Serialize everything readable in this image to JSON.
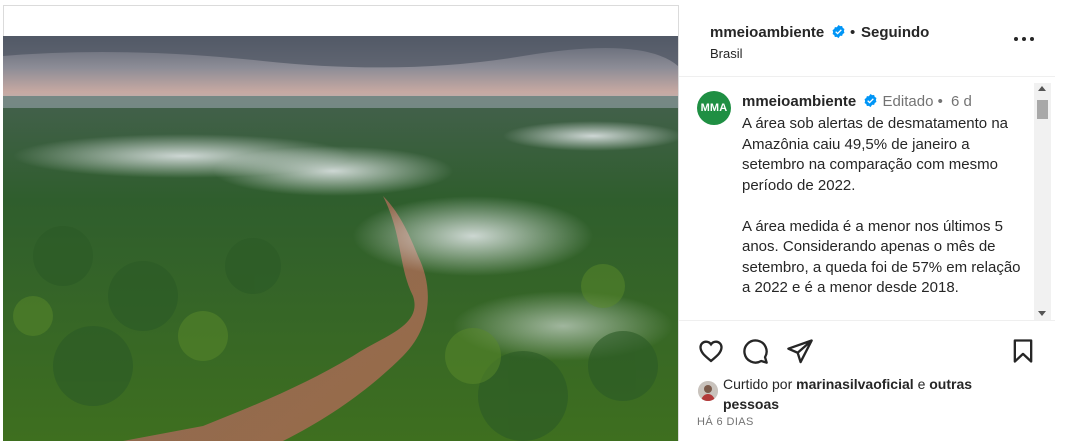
{
  "post": {
    "username": "mmeioambiente",
    "dot": "•",
    "follow_status": "Seguindo",
    "location": "Brasil",
    "avatar_text": "MMA",
    "edited_label": "Editado",
    "meta_dot": "•",
    "age": "6 d",
    "caption": "A área sob alertas de desmatamento na Amazônia caiu 49,5% de janeiro a setembro na comparação com mesmo período de 2022.\n\nA área medida é a menor nos últimos 5 anos. Considerando apenas o mês de setembro, a queda foi de 57% em relação a 2022 e é a menor desde 2018.",
    "liked_prefix": "Curtido por",
    "liked_user": "marinasilvaoficial",
    "liked_connector": "e",
    "liked_others": "outras pessoas",
    "date": "HÁ 6 DIAS"
  },
  "icons": {
    "verified": "verified-badge-icon",
    "more": "more-options-icon",
    "like": "heart-icon",
    "comment": "comment-icon",
    "share": "share-icon",
    "save": "bookmark-icon"
  },
  "colors": {
    "verified_blue": "#0095f6",
    "avatar_green": "#1f8f43",
    "muted_text": "#737373"
  }
}
